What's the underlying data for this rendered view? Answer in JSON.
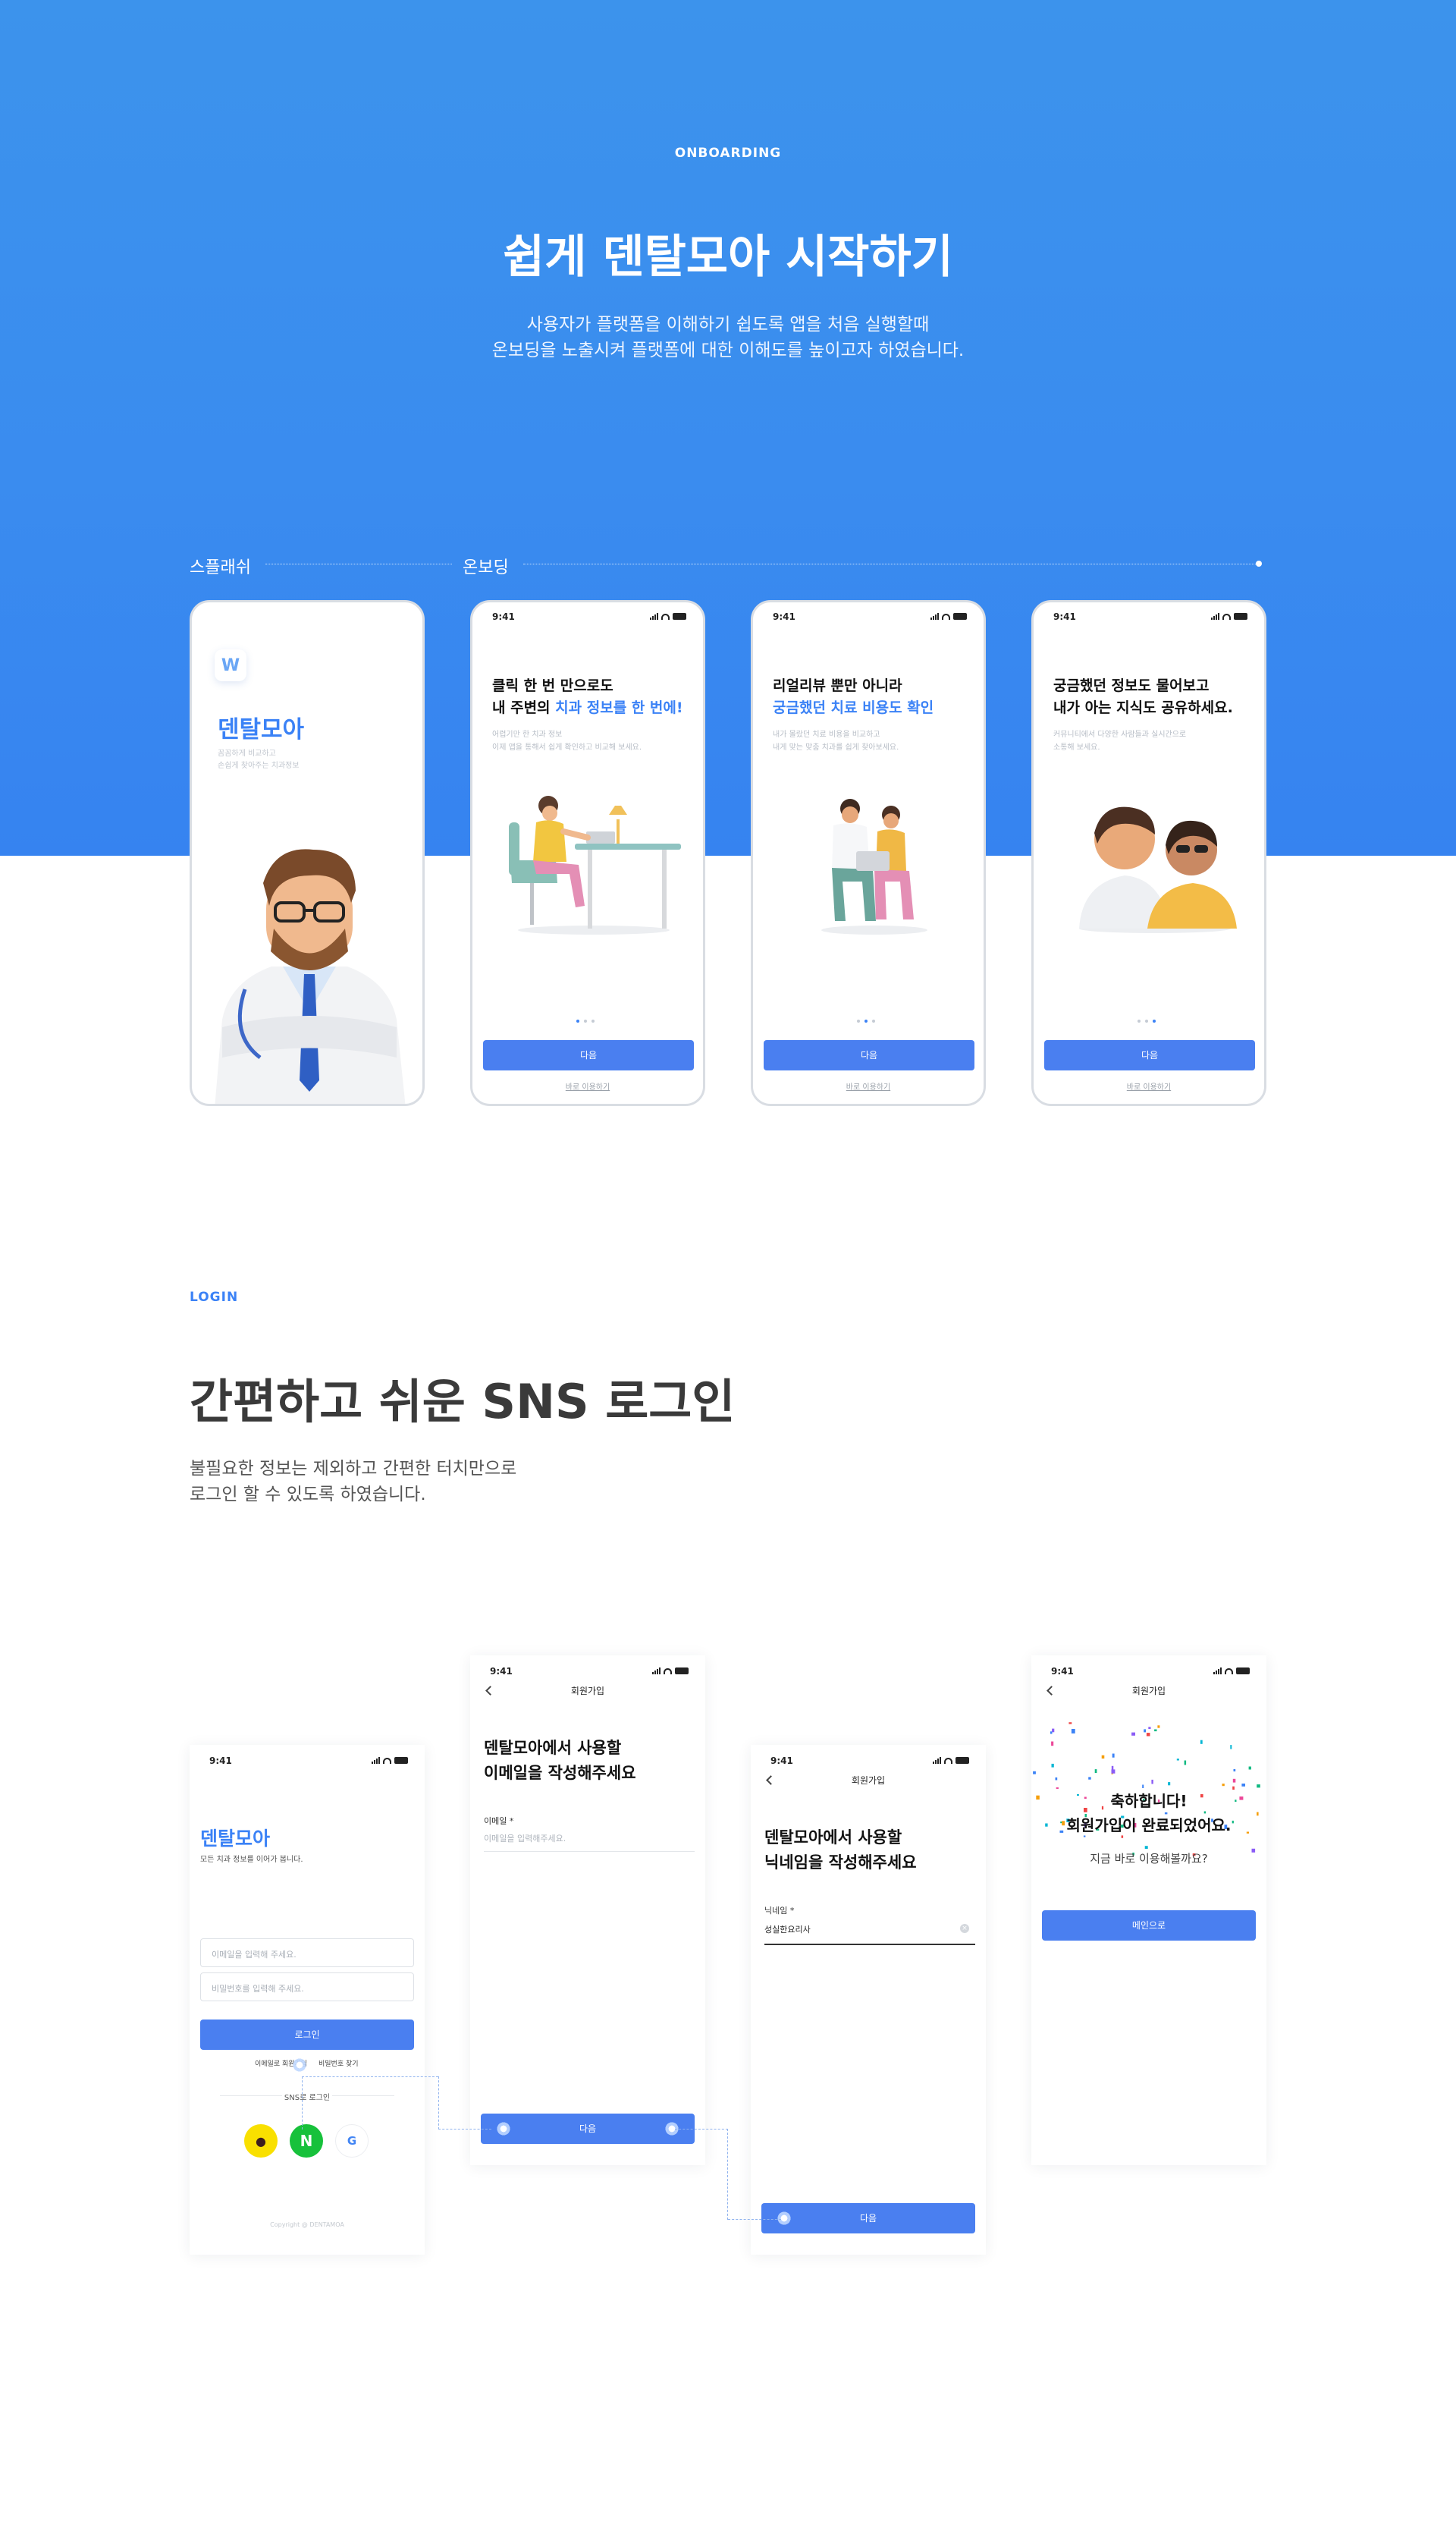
{
  "onboarding": {
    "eyebrow": "ONBOARDING",
    "title": "쉽게 덴탈모아 시작하기",
    "desc1": "사용자가 플랫폼을 이해하기 쉽도록 앱을 처음 실행할때",
    "desc2": "온보딩을 노출시켜 플랫폼에 대한 이해도를 높이고자 하였습니다.",
    "label_splash": "스플래쉬",
    "label_onboarding": "온보딩"
  },
  "status_time": "9:41",
  "splash": {
    "logo_letter": "W",
    "brand": "덴탈모아",
    "tag1": "꼼꼼하게 비교하고",
    "tag2": "손쉽게 찾아주는 치과정보"
  },
  "onboard_screens": [
    {
      "line1": "클릭 한 번 만으로도",
      "line2_pre": "내 주변의 ",
      "line2_hl": "치과 정보를 한 번에!",
      "sub1": "어렵기만 한 치과 정보",
      "sub2": "이제 앱을 통해서 쉽게 확인하고 비교해 보세요.",
      "button": "다음",
      "skip": "바로 이용하기"
    },
    {
      "line1": "리얼리뷰 뿐만 아니라",
      "line2_pre": "",
      "line2_hl": "궁금했던 치료 비용도 확인",
      "sub1": "내가 몰랐던 치료 비용을 비교하고",
      "sub2": "내게 맞는 맞춤 치과를 쉽게 찾아보세요.",
      "button": "다음",
      "skip": "바로 이용하기"
    },
    {
      "line1": "궁금했던 정보도 물어보고",
      "line2_pre": "내가 아는 지식도 공유하세요.",
      "line2_hl": "",
      "sub1": "커뮤니티에서 다양한 사람들과 실시간으로",
      "sub2": "소통해 보세요.",
      "button": "다음",
      "skip": "바로 이용하기"
    }
  ],
  "login": {
    "eyebrow": "LOGIN",
    "title": "간편하고 쉬운 SNS 로그인",
    "desc1": "불필요한 정보는 제외하고 간편한 터치만으로",
    "desc2": "로그인 할 수 있도록 하였습니다.",
    "screen": {
      "brand": "덴탈모아",
      "brand_sub": "모든 치과 정보를 이어가 봅니다.",
      "email_placeholder": "이메일을 입력해 주세요.",
      "password_placeholder": "비밀번호를 입력해 주세요.",
      "login_button": "로그인",
      "signup_link": "이메일로 회원가입",
      "find_pw_link": "비밀번호 찾기",
      "sns_label": "SNS로 로그인",
      "kakao_icon_text": "●",
      "naver_icon_text": "N",
      "google_icon_text": "G",
      "copyright": "Copyright @ DENTAMOA"
    },
    "signup_email": {
      "header": "회원가입",
      "title1": "덴탈모아에서 사용할",
      "title2": "이메일을 작성해주세요",
      "label": "이메일 *",
      "placeholder": "이메일을 입력해주세요.",
      "button": "다음"
    },
    "signup_nick": {
      "header": "회원가입",
      "title1": "덴탈모아에서 사용할",
      "title2": "닉네임을 작성해주세요",
      "label": "닉네임 *",
      "value": "성실한요리사",
      "button": "다음"
    },
    "complete": {
      "header": "회원가입",
      "line1": "축하합니다!",
      "line2": "회원가입이 완료되었어요.",
      "line3": "지금 바로 이용해볼까요?",
      "button": "메인으로"
    }
  },
  "colors": {
    "primary": "#3b82f6",
    "button": "#4a7ff0",
    "hero_top": "#3c93ec",
    "hero_bottom": "#3683f0"
  }
}
